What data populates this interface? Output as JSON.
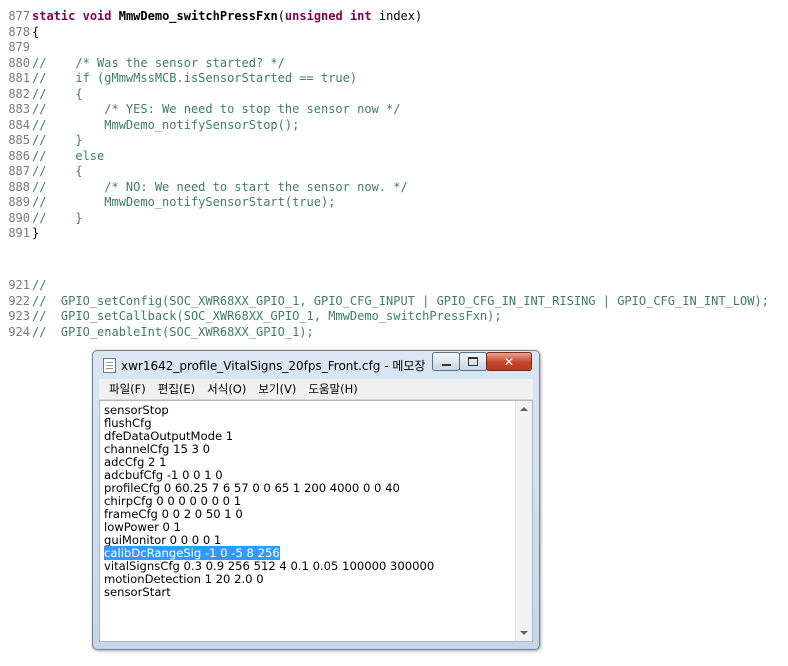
{
  "editor": {
    "lines": [
      {
        "n": "877",
        "kind": "sig",
        "kw1": "static",
        "kw2": "void",
        "name": "MmwDemo_switchPressFxn",
        "open": "(",
        "kw3": "unsigned",
        "kw4": "int",
        "rest": " index)"
      },
      {
        "n": "878",
        "kind": "plain",
        "text": "{"
      },
      {
        "n": "879",
        "kind": "plain",
        "text": ""
      },
      {
        "n": "880",
        "kind": "comment",
        "text": "//    /* Was the sensor started? */"
      },
      {
        "n": "881",
        "kind": "comment",
        "text": "//    if (gMmwMssMCB.isSensorStarted == true)"
      },
      {
        "n": "882",
        "kind": "comment",
        "text": "//    {"
      },
      {
        "n": "883",
        "kind": "comment",
        "text": "//        /* YES: We need to stop the sensor now */"
      },
      {
        "n": "884",
        "kind": "comment",
        "text": "//        MmwDemo_notifySensorStop();"
      },
      {
        "n": "885",
        "kind": "comment",
        "text": "//    }"
      },
      {
        "n": "886",
        "kind": "comment",
        "text": "//    else"
      },
      {
        "n": "887",
        "kind": "comment",
        "text": "//    {"
      },
      {
        "n": "888",
        "kind": "comment",
        "text": "//        /* NO: We need to start the sensor now. */"
      },
      {
        "n": "889",
        "kind": "comment",
        "text": "//        MmwDemo_notifySensorStart(true);"
      },
      {
        "n": "890",
        "kind": "comment",
        "text": "//    }"
      },
      {
        "n": "891",
        "kind": "plain",
        "text": "}"
      }
    ],
    "lines2": [
      {
        "n": "921",
        "text": "//"
      },
      {
        "n": "922",
        "text": "//  GPIO_setConfig(SOC_XWR68XX_GPIO_1, GPIO_CFG_INPUT | GPIO_CFG_IN_INT_RISING | GPIO_CFG_IN_INT_LOW);"
      },
      {
        "n": "923",
        "text": "//  GPIO_setCallback(SOC_XWR68XX_GPIO_1, MmwDemo_switchPressFxn);"
      },
      {
        "n": "924",
        "text": "//  GPIO_enableInt(SOC_XWR68XX_GPIO_1);"
      }
    ]
  },
  "notepad": {
    "title": "xwr1642_profile_VitalSigns_20fps_Front.cfg - 메모장",
    "minimize_icon": "minimize-icon",
    "maximize_icon": "maximize-icon",
    "close_label": "✕",
    "menu": [
      "파일(F)",
      "편집(E)",
      "서식(O)",
      "보기(V)",
      "도움말(H)"
    ],
    "selected_line_index": 11,
    "content": [
      "sensorStop",
      "flushCfg",
      "dfeDataOutputMode 1",
      "channelCfg 15 3 0",
      "adcCfg 2 1",
      "adcbufCfg -1 0 0 1 0",
      "profileCfg 0 60.25 7 6 57 0 0 65 1 200 4000 0 0 40",
      "chirpCfg 0 0 0 0 0 0 0 1",
      "frameCfg 0 0 2 0 50 1 0",
      "lowPower 0 1",
      "guiMonitor 0 0 0 0 1",
      "calibDcRangeSig -1 0 -5 8 256",
      "vitalSignsCfg 0.3 0.9 256 512 4 0.1 0.05 100000 300000",
      "motionDetection 1 20 2.0 0",
      "sensorStart"
    ]
  }
}
